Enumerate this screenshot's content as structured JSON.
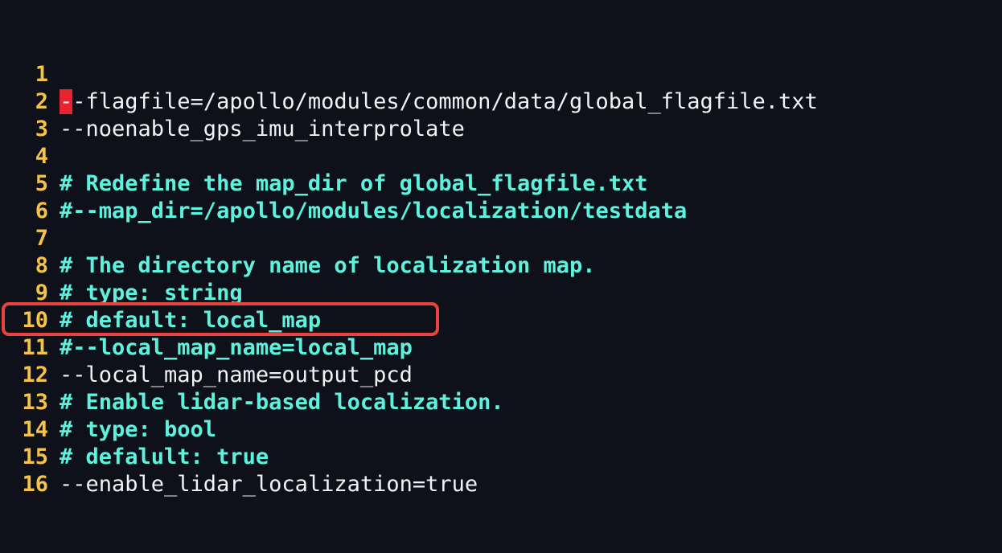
{
  "editor": {
    "cursor_char": "-",
    "lines": [
      {
        "num": "1",
        "text": "-flagfile=/apollo/modules/common/data/global_flagfile.txt",
        "kind": "code"
      },
      {
        "num": "2",
        "text": "--noenable_gps_imu_interprolate",
        "kind": "code"
      },
      {
        "num": "3",
        "text": "",
        "kind": "code"
      },
      {
        "num": "4",
        "text": "# Redefine the map_dir of global_flagfile.txt",
        "kind": "comment"
      },
      {
        "num": "5",
        "text": "#--map_dir=/apollo/modules/localization/testdata",
        "kind": "comment"
      },
      {
        "num": "6",
        "text": "",
        "kind": "code"
      },
      {
        "num": "7",
        "text": "# The directory name of localization map.",
        "kind": "comment"
      },
      {
        "num": "8",
        "text": "# type: string",
        "kind": "comment"
      },
      {
        "num": "9",
        "text": "# default: local_map",
        "kind": "comment"
      },
      {
        "num": "10",
        "text": "#--local_map_name=local_map",
        "kind": "comment"
      },
      {
        "num": "11",
        "text": "--local_map_name=output_pcd",
        "kind": "code"
      },
      {
        "num": "12",
        "text": "# Enable lidar-based localization.",
        "kind": "comment"
      },
      {
        "num": "13",
        "text": "# type: bool",
        "kind": "comment"
      },
      {
        "num": "14",
        "text": "# defalult: true",
        "kind": "comment"
      },
      {
        "num": "15",
        "text": "--enable_lidar_localization=true",
        "kind": "code"
      },
      {
        "num": "16",
        "text": "",
        "kind": "code"
      }
    ]
  },
  "colors": {
    "background": "#0f111a",
    "line_number": "#f6c34a",
    "code_text": "#f2f3f5",
    "comment_text": "#5ef1de",
    "cursor": "#e8222e",
    "highlight_border": "#e8433f"
  }
}
